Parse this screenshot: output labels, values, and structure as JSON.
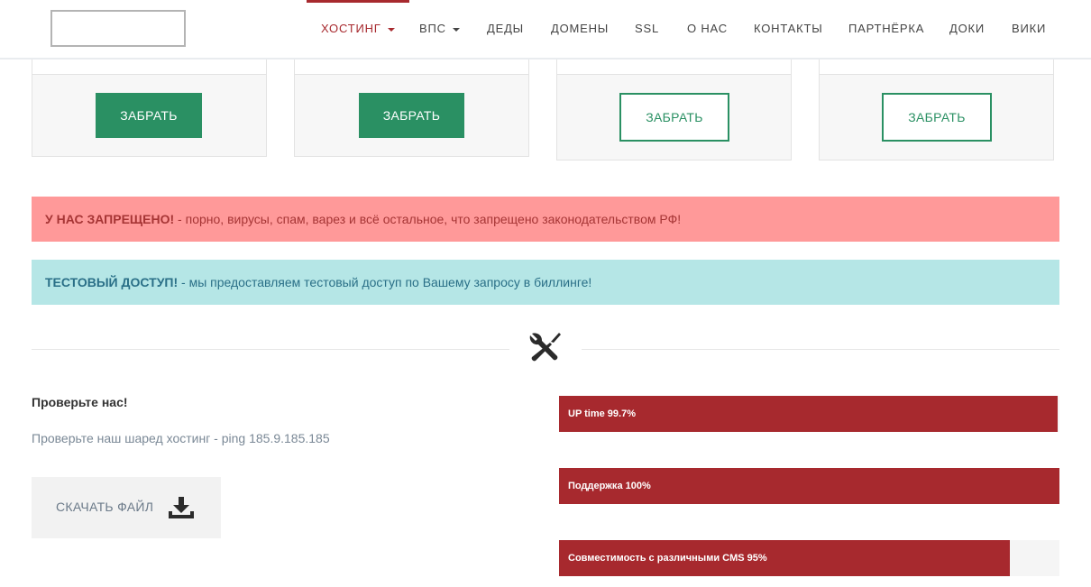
{
  "nav": {
    "items": [
      {
        "label": "ХОСТИНГ",
        "active": true,
        "dropdown": true
      },
      {
        "label": "ВПС",
        "active": false,
        "dropdown": true
      },
      {
        "label": "ДЕДЫ",
        "active": false,
        "dropdown": false
      },
      {
        "label": "ДОМЕНЫ",
        "active": false,
        "dropdown": false
      },
      {
        "label": "SSL",
        "active": false,
        "dropdown": false
      },
      {
        "label": "О НАС",
        "active": false,
        "dropdown": false
      },
      {
        "label": "КОНТАКТЫ",
        "active": false,
        "dropdown": false
      },
      {
        "label": "ПАРТНЁРКА",
        "active": false,
        "dropdown": false
      },
      {
        "label": "ДОКИ",
        "active": false,
        "dropdown": false
      },
      {
        "label": "ВИКИ",
        "active": false,
        "dropdown": false
      }
    ]
  },
  "plans": [
    {
      "button_label": "ЗАБРАТЬ",
      "style": "solid"
    },
    {
      "button_label": "ЗАБРАТЬ",
      "style": "solid"
    },
    {
      "button_label": "ЗАБРАТЬ",
      "style": "outline"
    },
    {
      "button_label": "ЗАБРАТЬ",
      "style": "outline"
    }
  ],
  "alerts": {
    "danger": {
      "title": "У НАС ЗАПРЕЩЕНО!",
      "text": " - порно, вирусы, спам, варез и всё остальное, что запрещено законодательством РФ!"
    },
    "info": {
      "title": "ТЕСТОВЫЙ ДОСТУП!",
      "text": " - мы предоставляем тестовый доступ по Вашему запросу в биллинге!"
    }
  },
  "divider_icon": "tools-icon",
  "check": {
    "title": "Проверьте нас!",
    "text": "Проверьте наш шаред хостинг - ping 185.9.185.185",
    "download_label": "СКАЧАТЬ ФАЙЛ",
    "download_icon": "download-icon"
  },
  "progress": [
    {
      "label": "UP time 99.7%",
      "value": 0.997
    },
    {
      "label": "Поддержка 100%",
      "value": 1.0
    },
    {
      "label": "Совместимость с различными CMS 95%",
      "value": 0.9
    }
  ],
  "colors": {
    "brand_red": "#a7292e",
    "brand_green": "#2a9063",
    "danger_bg": "#ff9999",
    "info_bg": "#b5e6e6"
  }
}
